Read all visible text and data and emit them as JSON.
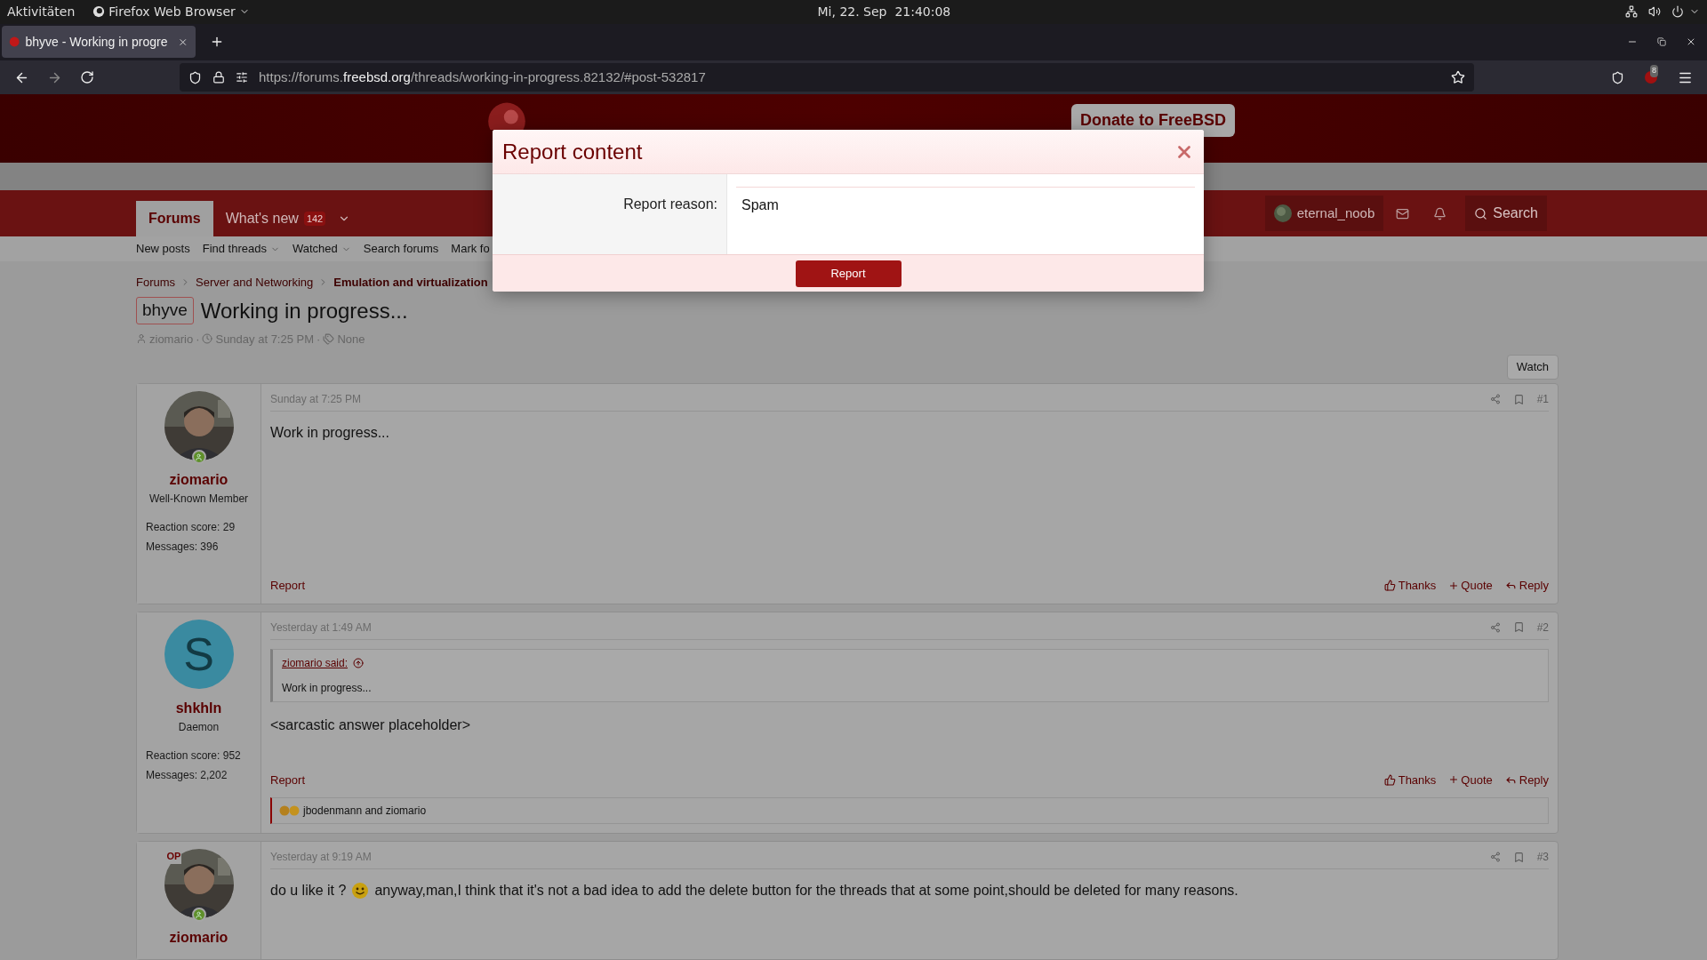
{
  "system_bar": {
    "activities": "Aktivitäten",
    "app": "Firefox Web Browser",
    "clock": "Mi, 22. Sep  21:40:08"
  },
  "browser": {
    "tabs": [
      {
        "title": "bhyve - Working in progre",
        "selected": true
      }
    ],
    "url": {
      "prefix": "https://forums.",
      "host": "freebsd.org",
      "path": "/threads/working-in-progress.82132/#post-532817"
    },
    "extension_badge": "8"
  },
  "site": {
    "donate": "Donate to FreeBSD",
    "nav_tabs": [
      {
        "label": "Forums",
        "selected": true
      },
      {
        "label": "What's new",
        "badge": "142",
        "selected": false
      }
    ],
    "user": "eternal_noob",
    "search": "Search",
    "subnav": [
      {
        "label": "New posts",
        "dropdown": false
      },
      {
        "label": "Find threads",
        "dropdown": true
      },
      {
        "label": "Watched",
        "dropdown": true
      },
      {
        "label": "Search forums",
        "dropdown": false
      },
      {
        "label": "Mark fo",
        "dropdown": false
      }
    ]
  },
  "breadcrumbs": [
    {
      "label": "Forums",
      "current": false
    },
    {
      "label": "Server and Networking",
      "current": false
    },
    {
      "label": "Emulation and virtualization",
      "current": true
    }
  ],
  "thread": {
    "prefix": "bhyve",
    "title": "Working in progress...",
    "author": "ziomario",
    "date": "Sunday at 7:25 PM",
    "tags": "None",
    "separator": "·",
    "watch": "Watch"
  },
  "posts": [
    {
      "avatar": {
        "kind": "picture"
      },
      "op": false,
      "online": true,
      "user": "ziomario",
      "role": "Well-Known Member",
      "stats": [
        "Reaction score: 29",
        "Messages: 396"
      ],
      "date": "Sunday at 7:25 PM",
      "number": "#1",
      "body": "Work in progress...",
      "actions": {
        "report": "Report",
        "thanks": "Thanks",
        "quote": "Quote",
        "reply": "Reply"
      }
    },
    {
      "avatar": {
        "kind": "letter",
        "letter": "S",
        "color": "#3a8aa0"
      },
      "op": false,
      "online": false,
      "user": "shkhln",
      "role": "Daemon",
      "stats": [
        "Reaction score: 952",
        "Messages: 2,202"
      ],
      "date": "Yesterday at 1:49 AM",
      "number": "#2",
      "quote": {
        "author": "ziomario said:",
        "text": "Work in progress..."
      },
      "body": "<sarcastic answer placeholder>",
      "actions": {
        "report": "Report",
        "thanks": "Thanks",
        "quote": "Quote",
        "reply": "Reply"
      },
      "reactions": "jbodenmann and ziomario"
    },
    {
      "avatar": {
        "kind": "picture"
      },
      "op": true,
      "op_label": "OP",
      "online": true,
      "user": "ziomario",
      "date": "Yesterday at 9:19 AM",
      "number": "#3",
      "body": "do u like it ?",
      "smilie": true,
      "body_after": "anyway,man,I think that it's not a bad idea to add the delete button for the threads that at some point,should be deleted for many reasons."
    }
  ],
  "modal": {
    "title": "Report content",
    "label": "Report reason:",
    "value": "Spam",
    "submit": "Report"
  }
}
